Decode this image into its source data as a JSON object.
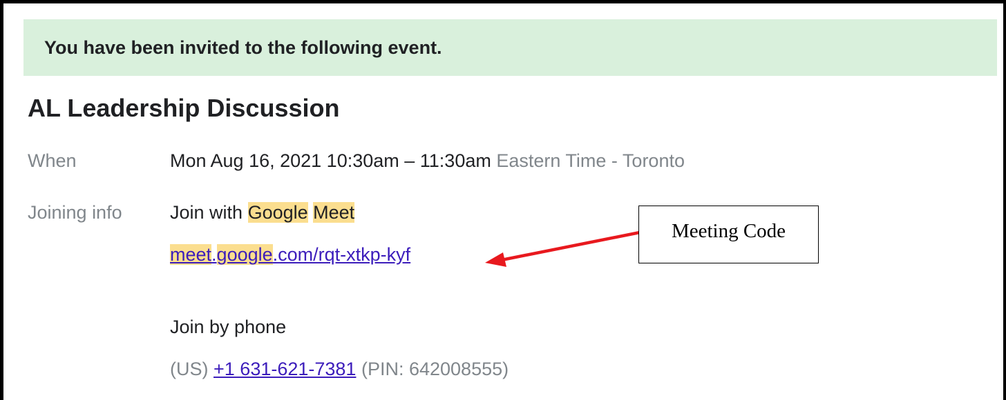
{
  "banner": {
    "text": "You have been invited to the following event."
  },
  "event": {
    "title": "AL Leadership Discussion",
    "when_label": "When",
    "when_value": "Mon Aug 16, 2021 10:30am – 11:30am",
    "timezone": "Eastern Time - Toronto",
    "joining_label": "Joining info",
    "join_meet_prefix": "Join with ",
    "join_meet_word1": "Google",
    "join_meet_word2": "Meet",
    "meet_link_part1": "meet",
    "meet_link_part2": "google",
    "meet_link_part3": ".com/rqt-xtkp-kyf",
    "join_phone_label": "Join by phone",
    "phone_region": "(US)",
    "phone_number": "+1 631-621-7381",
    "phone_pin": "(PIN: 642008555)"
  },
  "annotation": {
    "text": "Meeting Code",
    "arrow_color": "#e8191e"
  },
  "colors": {
    "banner_bg": "#d9f0dc",
    "highlight": "#fbde8f",
    "link": "#3c1dbb",
    "muted": "#80868b"
  }
}
